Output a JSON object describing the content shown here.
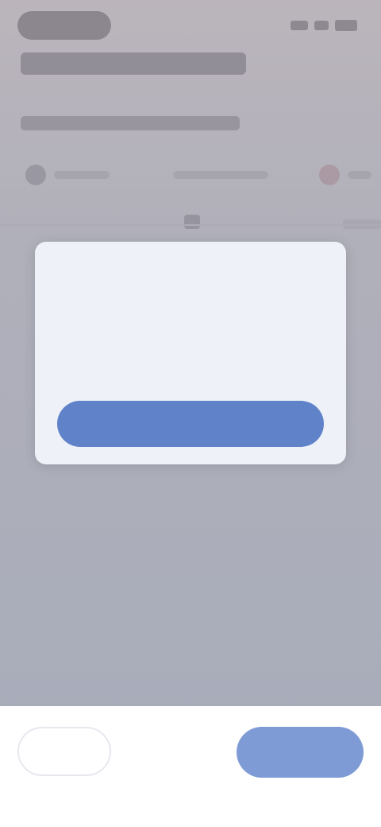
{
  "status_bar": {
    "time": "",
    "icons": [
      "signal-icon",
      "wifi-icon",
      "battery-icon"
    ]
  },
  "screen": {
    "title": "",
    "subtitle": "",
    "tabs": [
      {
        "label": "",
        "icon": "tab-icon"
      },
      {
        "label": "",
        "icon": "tab-icon"
      },
      {
        "label": "",
        "icon": "tab-icon"
      }
    ]
  },
  "dialog": {
    "title": "",
    "body": "",
    "ok_label": ""
  },
  "bottom_bar": {
    "secondary_label": "",
    "primary_label": ""
  },
  "colors": {
    "accent": "#5f82c9",
    "dialog_title": "#2f4fa0",
    "dialog_bg": "#eef1f8",
    "primary_button": "#7e9bd6"
  }
}
